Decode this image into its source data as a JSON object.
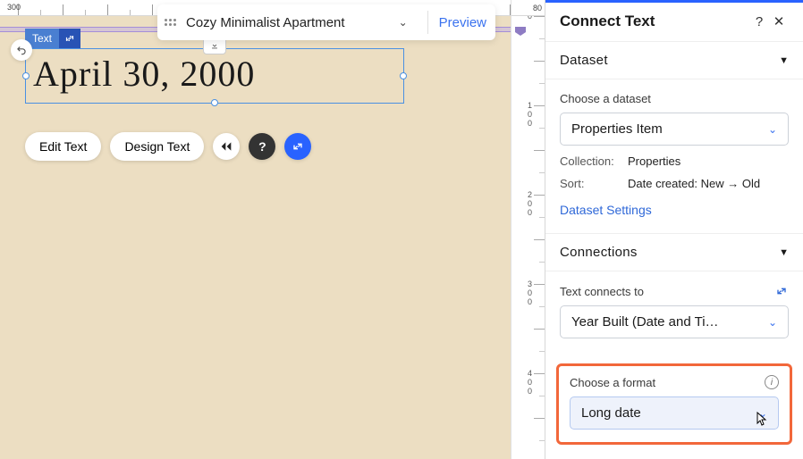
{
  "ruler": {
    "topStart": "300",
    "right_corner": "80"
  },
  "breadcrumb": {
    "title": "Cozy Minimalist Apartment",
    "preview": "Preview"
  },
  "textElement": {
    "badge": "Text",
    "content": "April 30, 2000"
  },
  "actions": {
    "edit": "Edit Text",
    "design": "Design Text"
  },
  "panel": {
    "title": "Connect Text",
    "sections": {
      "dataset": {
        "header": "Dataset",
        "choose_label": "Choose a dataset",
        "value": "Properties Item",
        "collection_label": "Collection:",
        "collection_value": "Properties",
        "sort_label": "Sort:",
        "sort_value": "Date created: New → Old",
        "settings_link": "Dataset Settings"
      },
      "connections": {
        "header": "Connections",
        "connects_label": "Text connects to",
        "connects_value": "Year Built (Date and Ti…",
        "format_label": "Choose a format",
        "format_value": "Long date"
      }
    }
  }
}
